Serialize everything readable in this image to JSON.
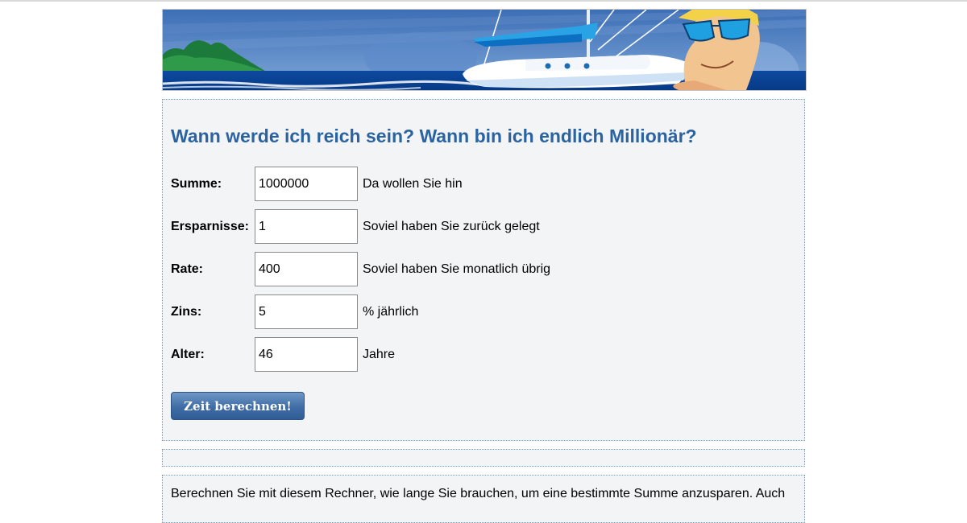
{
  "header": {
    "banner_alt": "sailboat-banner"
  },
  "main": {
    "title": "Wann werde ich reich sein? Wann bin ich endlich Millionär?",
    "fields": [
      {
        "label": "Summe:",
        "value": "1000000",
        "hint": "Da wollen Sie hin"
      },
      {
        "label": "Ersparnisse:",
        "value": "1",
        "hint": "Soviel haben Sie zurück gelegt"
      },
      {
        "label": "Rate:",
        "value": "400",
        "hint": "Soviel haben Sie monatlich übrig"
      },
      {
        "label": "Zins:",
        "value": "5",
        "hint": "% jährlich"
      },
      {
        "label": "Alter:",
        "value": "46",
        "hint": "Jahre"
      }
    ],
    "submit_label": "Zeit berechnen!"
  },
  "description": {
    "text": "Berechnen Sie mit diesem Rechner, wie lange Sie brauchen, um eine bestimmte Summe anzusparen. Auch"
  },
  "colors": {
    "title": "#2a63a0",
    "panel_bg": "#f3f4f5",
    "button": "#3f6da6",
    "sea": "#0d4aa0"
  }
}
